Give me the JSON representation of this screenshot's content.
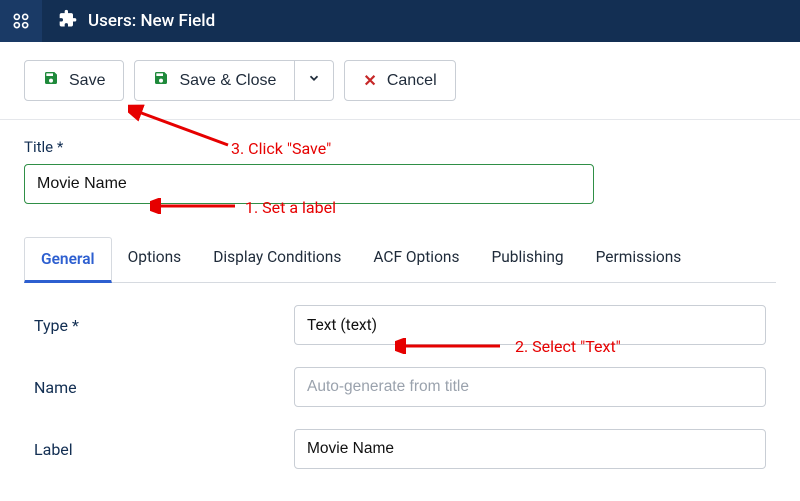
{
  "header": {
    "title": "Users: New Field"
  },
  "toolbar": {
    "save": "Save",
    "save_close": "Save & Close",
    "cancel": "Cancel"
  },
  "title_field": {
    "label": "Title *",
    "value": "Movie Name"
  },
  "tabs": {
    "general": "General",
    "options": "Options",
    "display_conditions": "Display Conditions",
    "acf_options": "ACF Options",
    "publishing": "Publishing",
    "permissions": "Permissions"
  },
  "form": {
    "type_label": "Type *",
    "type_value": "Text (text)",
    "name_label": "Name",
    "name_placeholder": "Auto-generate from title",
    "label_label": "Label",
    "label_value": "Movie Name"
  },
  "annotations": {
    "a1": "1. Set a label",
    "a2": "2. Select \"Text\"",
    "a3": "3. Click \"Save\""
  }
}
